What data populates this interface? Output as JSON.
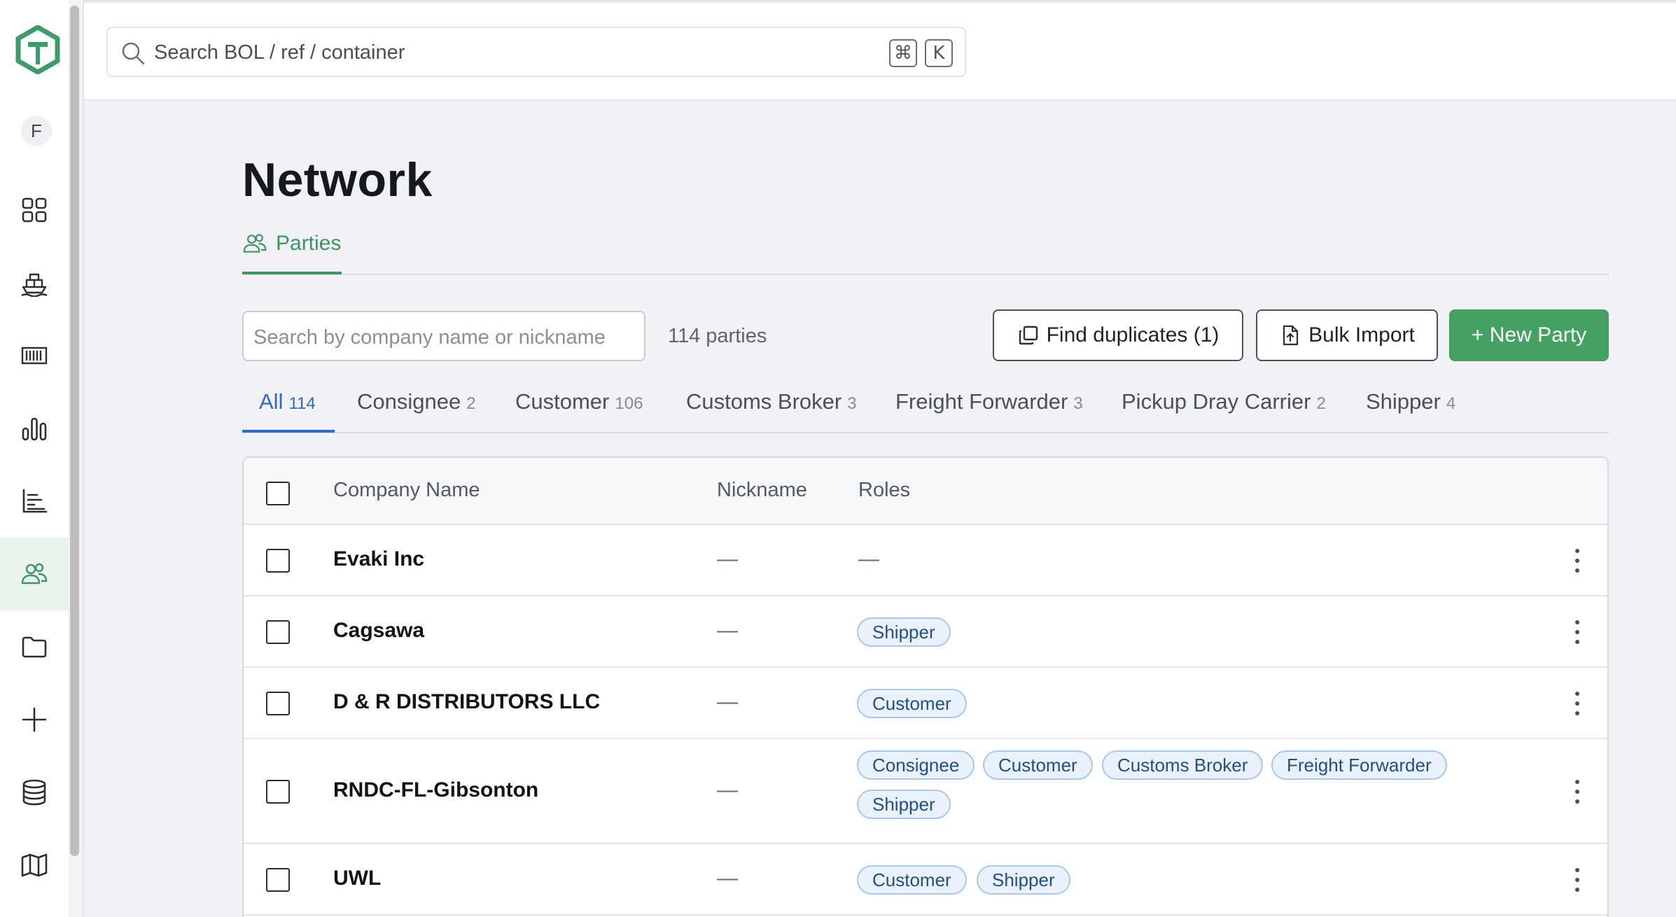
{
  "sidebar": {
    "avatar_initial": "F",
    "icons": [
      "dashboard-grid-icon",
      "ship-icon",
      "container-icon",
      "bar-chart-icon",
      "list-chart-icon",
      "people-icon",
      "folder-icon",
      "plus-icon",
      "database-icon",
      "map-icon"
    ],
    "active_item": "people-icon"
  },
  "topbar": {
    "search_placeholder": "Search BOL / ref / container",
    "shortcut_keys": [
      "⌘",
      "K"
    ]
  },
  "page": {
    "title": "Network",
    "section_tab": "Parties",
    "search_placeholder": "Search by company name or nickname",
    "party_count": "114 parties",
    "buttons": {
      "find_duplicates": "Find duplicates (1)",
      "bulk_import": "Bulk Import",
      "new_party": "+ New Party"
    }
  },
  "filters": [
    {
      "label": "All",
      "count": "114"
    },
    {
      "label": "Consignee",
      "count": "2"
    },
    {
      "label": "Customer",
      "count": "106"
    },
    {
      "label": "Customs Broker",
      "count": "3"
    },
    {
      "label": "Freight Forwarder",
      "count": "3"
    },
    {
      "label": "Pickup Dray Carrier",
      "count": "2"
    },
    {
      "label": "Shipper",
      "count": "4"
    }
  ],
  "table": {
    "columns": [
      "Company Name",
      "Nickname",
      "Roles"
    ],
    "rows": [
      {
        "company": "Evaki Inc",
        "nickname": "—",
        "roles_text": "—",
        "roles": []
      },
      {
        "company": "Cagsawa",
        "nickname": "—",
        "roles": [
          "Shipper"
        ]
      },
      {
        "company": "D & R DISTRIBUTORS LLC",
        "nickname": "—",
        "roles": [
          "Customer"
        ]
      },
      {
        "company": "RNDC-FL-Gibsonton",
        "nickname": "—",
        "roles": [
          "Consignee",
          "Customer",
          "Customs Broker",
          "Freight Forwarder",
          "Shipper"
        ]
      },
      {
        "company": "UWL",
        "nickname": "—",
        "roles": [
          "Customer",
          "Shipper"
        ]
      }
    ]
  },
  "colors": {
    "accent_green": "#45a163",
    "active_tab_blue": "#3066c6",
    "chip_bg": "#e8f1fc",
    "chip_border": "#a9c8ec"
  }
}
